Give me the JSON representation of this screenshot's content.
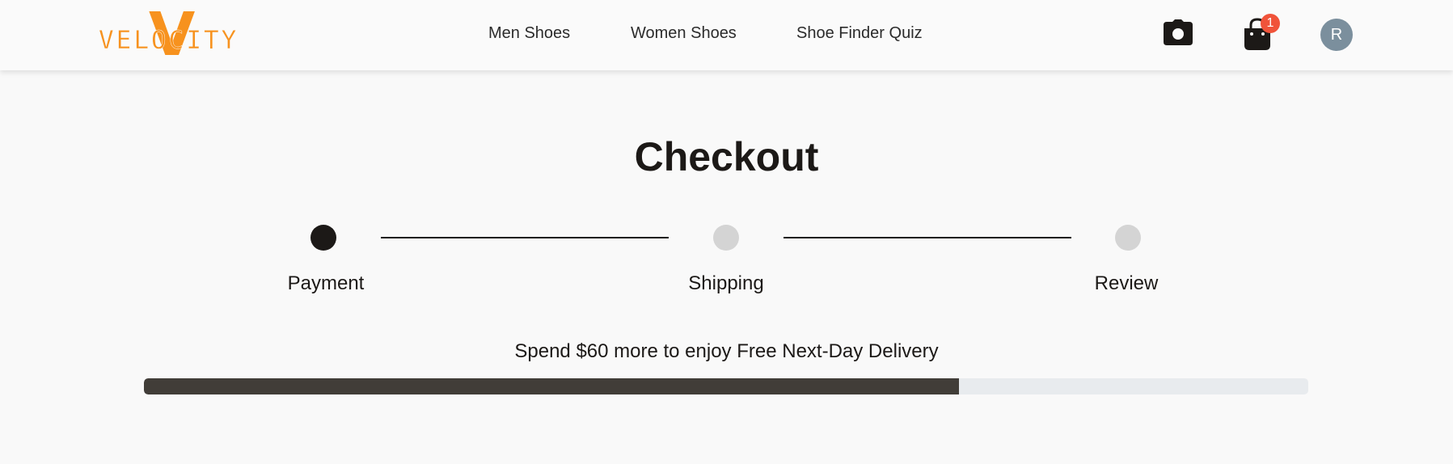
{
  "header": {
    "logo": {
      "mark": "V",
      "text": "VELOCITY",
      "color": "#f7921e"
    },
    "nav": [
      {
        "label": "Men Shoes"
      },
      {
        "label": "Women Shoes"
      },
      {
        "label": "Shoe Finder Quiz"
      }
    ],
    "icons": {
      "camera": "camera-icon",
      "cart": "shopping-bag-icon"
    },
    "cart_count": "1",
    "avatar_initial": "R"
  },
  "checkout": {
    "title": "Checkout",
    "steps": [
      {
        "label": "Payment",
        "active": true
      },
      {
        "label": "Shipping",
        "active": false
      },
      {
        "label": "Review",
        "active": false
      }
    ]
  },
  "delivery_promo": {
    "text": "Spend $60 more to enjoy Free Next-Day Delivery",
    "progress_fraction": 0.7
  },
  "colors": {
    "brand_orange": "#f7921e",
    "badge": "#f0533a",
    "avatar": "#7b8f9d",
    "step_active": "#1c1917",
    "step_inactive": "#d4d4d4",
    "progress_fill": "#413d38",
    "progress_track": "#e8ebee"
  }
}
